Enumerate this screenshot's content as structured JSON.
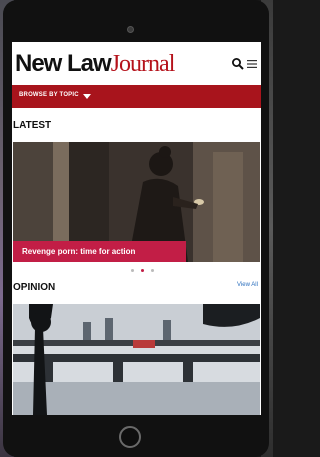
{
  "logo": {
    "part1": "New Law",
    "part2": "Journal"
  },
  "nav": {
    "browse_label": "BROWSE BY TOPIC"
  },
  "sections": {
    "latest": "LATEST",
    "opinion": "OPINION"
  },
  "hero": {
    "caption": "Revenge porn: time for action"
  },
  "carousel": {
    "count": 3,
    "active_index": 1
  },
  "opinion": {
    "view_all": "View All"
  },
  "colors": {
    "brand_red": "#a8141c",
    "caption_red": "#c21e46",
    "link_blue": "#2a6ebd"
  },
  "icons": {
    "search": "search-icon",
    "menu": "hamburger-menu-icon",
    "dropdown": "caret-down-icon"
  }
}
